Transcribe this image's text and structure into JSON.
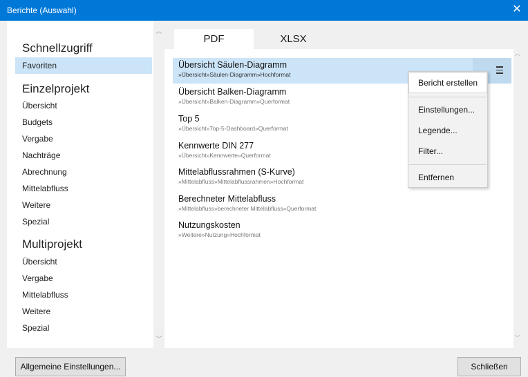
{
  "window": {
    "title": "Berichte (Auswahl)",
    "close_glyph": "✕"
  },
  "sidebar": {
    "sections": [
      {
        "heading": "Schnellzugriff",
        "items": [
          "Favoriten"
        ]
      },
      {
        "heading": "Einzelprojekt",
        "items": [
          "Übersicht",
          "Budgets",
          "Vergabe",
          "Nachträge",
          "Abrechnung",
          "Mittelabfluss",
          "Weitere",
          "Spezial"
        ]
      },
      {
        "heading": "Multiprojekt",
        "items": [
          "Übersicht",
          "Vergabe",
          "Mittelabfluss",
          "Weitere",
          "Spezial"
        ]
      }
    ],
    "selected": "Favoriten"
  },
  "tabs": [
    {
      "label": "PDF",
      "active": true
    },
    {
      "label": "XLSX",
      "active": false
    }
  ],
  "reports": [
    {
      "title": "Übersicht Säulen-Diagramm",
      "path": "»Übersicht»Säulen-Diagramm»Hochformat",
      "selected": true
    },
    {
      "title": "Übersicht Balken-Diagramm",
      "path": "»Übersicht»Balken-Diagramm»Querformat"
    },
    {
      "title": "Top 5",
      "path": "»Übersicht»Top-5-Dashboard»Querformat"
    },
    {
      "title": "Kennwerte DIN 277",
      "path": "»Übersicht»Kennwerte»Querformat"
    },
    {
      "title": "Mittelabflussrahmen (S-Kurve)",
      "path": "»Mittelabfluss»Mittelabflussrahmen»Hochformat"
    },
    {
      "title": "Berechneter Mittelabfluss",
      "path": "»Mittelabfluss»berechneter Mittelabfluss»Querformat"
    },
    {
      "title": "Nutzungskosten",
      "path": "»Weitere»Nutzung»Hochformat"
    }
  ],
  "context_menu": {
    "items": [
      "Bericht erstellen",
      "Einstellungen...",
      "Legende...",
      "Filter...",
      "Entfernen"
    ],
    "hovered": "Bericht erstellen"
  },
  "footer": {
    "settings_label": "Allgemeine Einstellungen...",
    "close_label": "Schließen"
  },
  "icons": {
    "menu": "hamburger-icon",
    "scroll_up": "chevron-up-icon",
    "scroll_down": "chevron-down-icon",
    "close": "close-icon"
  },
  "colors": {
    "titlebar": "#0078d7",
    "selection": "#cce4f7",
    "menu_button": "#bfd9ef"
  }
}
